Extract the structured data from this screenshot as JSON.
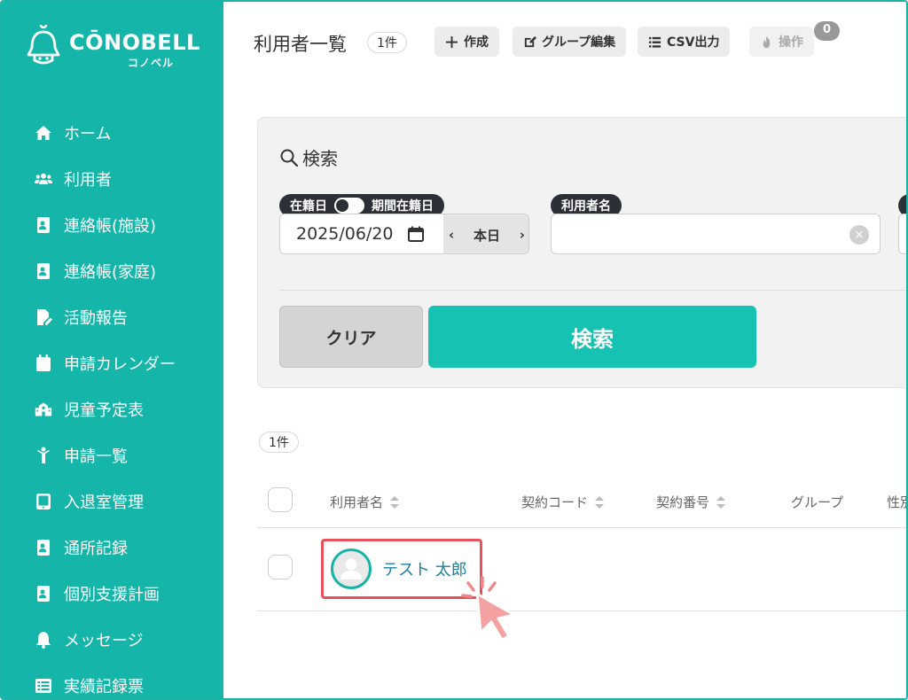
{
  "brand": {
    "name": "CŌNOBELL",
    "sub": "コノベル"
  },
  "sidebar": {
    "items": [
      {
        "label": "ホーム",
        "icon": "home-icon"
      },
      {
        "label": "利用者",
        "icon": "users-icon"
      },
      {
        "label": "連絡帳(施設)",
        "icon": "contact-book-icon"
      },
      {
        "label": "連絡帳(家庭)",
        "icon": "contact-book-icon"
      },
      {
        "label": "活動報告",
        "icon": "file-edit-icon"
      },
      {
        "label": "申請カレンダー",
        "icon": "calendar-icon"
      },
      {
        "label": "児童予定表",
        "icon": "school-icon"
      },
      {
        "label": "申請一覧",
        "icon": "child-icon"
      },
      {
        "label": "入退室管理",
        "icon": "tablet-icon"
      },
      {
        "label": "通所記録",
        "icon": "contact-book-icon"
      },
      {
        "label": "個別支援計画",
        "icon": "contact-book-icon"
      },
      {
        "label": "メッセージ",
        "icon": "bell-icon"
      },
      {
        "label": "実績記録票",
        "icon": "list-icon"
      }
    ]
  },
  "header": {
    "title": "利用者一覧",
    "count": "1件",
    "buttons": {
      "create": "作成",
      "group_edit": "グループ編集",
      "csv": "CSV出力",
      "operate": "操作"
    },
    "operate_badge": "0"
  },
  "search": {
    "title": "検索",
    "period_label_left": "在籍日",
    "period_label_right": "期間在籍日",
    "date_value": "2025/06/20",
    "today_label": "本日",
    "prev_arrow": "‹",
    "next_arrow": "›",
    "name_label": "利用者名",
    "name_value": "",
    "clear_symbol": "×",
    "clear_button": "クリア",
    "search_button": "検索"
  },
  "results": {
    "count": "1件",
    "columns": [
      "利用者名",
      "契約コード",
      "契約番号",
      "グループ",
      "性別"
    ],
    "rows": [
      {
        "name": "テスト 太郎"
      }
    ]
  },
  "colors": {
    "sidebar_bg": "#15b6a9",
    "primary": "#16c3b3",
    "highlight": "#e8505b",
    "link": "#1a7fa0"
  }
}
